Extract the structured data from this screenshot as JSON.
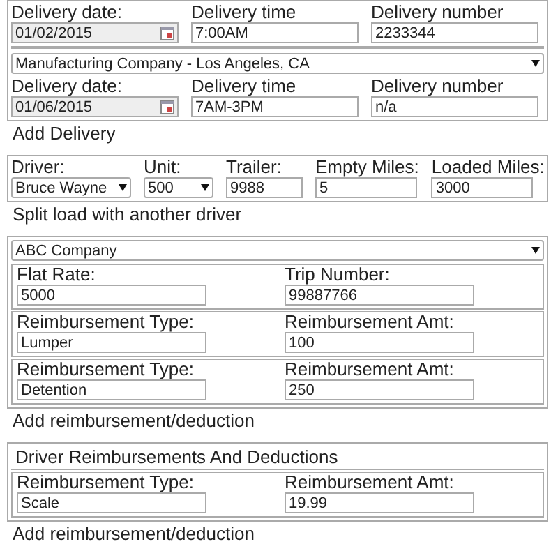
{
  "deliveries": [
    {
      "fields": [
        {
          "kind": "date",
          "label": "Delivery date:",
          "value": "01/02/2015"
        },
        {
          "kind": "text",
          "label": "Delivery time",
          "value": "7:00AM"
        },
        {
          "kind": "text",
          "label": "Delivery number",
          "value": "2233344"
        }
      ]
    },
    {
      "company": "Manufacturing Company - Los Angeles, CA",
      "fields": [
        {
          "kind": "date",
          "label": "Delivery date:",
          "value": "01/06/2015"
        },
        {
          "kind": "text",
          "label": "Delivery time",
          "value": "7AM-3PM"
        },
        {
          "kind": "text",
          "label": "Delivery number",
          "value": "n/a"
        }
      ]
    }
  ],
  "add_delivery_link": "Add Delivery",
  "driver_fields": [
    {
      "kind": "select",
      "label": "Driver:",
      "value": "Bruce Wayne"
    },
    {
      "kind": "select",
      "label": "Unit:",
      "value": "500"
    },
    {
      "kind": "text",
      "label": "Trailer:",
      "value": "9988"
    },
    {
      "kind": "text",
      "label": "Empty Miles:",
      "value": "5"
    },
    {
      "kind": "text",
      "label": "Loaded Miles:",
      "value": "3000"
    }
  ],
  "split_load_link": "Split load with another driver",
  "customer": {
    "company": "ABC Company",
    "rows": [
      [
        {
          "kind": "text",
          "label": "Flat Rate:",
          "value": "5000"
        },
        {
          "kind": "text",
          "label": "Trip Number:",
          "value": "99887766"
        }
      ],
      [
        {
          "kind": "text",
          "label": "Reimbursement Type:",
          "value": "Lumper"
        },
        {
          "kind": "text",
          "label": "Reimbursement Amt:",
          "value": "100"
        }
      ],
      [
        {
          "kind": "text",
          "label": "Reimbursement Type:",
          "value": "Detention"
        },
        {
          "kind": "text",
          "label": "Reimbursement Amt:",
          "value": "250"
        }
      ]
    ],
    "add_link": "Add reimbursement/deduction"
  },
  "driver_reimbursements": {
    "title": "Driver Reimbursements And Deductions",
    "rows": [
      [
        {
          "kind": "text",
          "label": "Reimbursement Type:",
          "value": "Scale"
        },
        {
          "kind": "text",
          "label": "Reimbursement Amt:",
          "value": "19.99"
        }
      ]
    ],
    "add_link": "Add reimbursement/deduction"
  }
}
